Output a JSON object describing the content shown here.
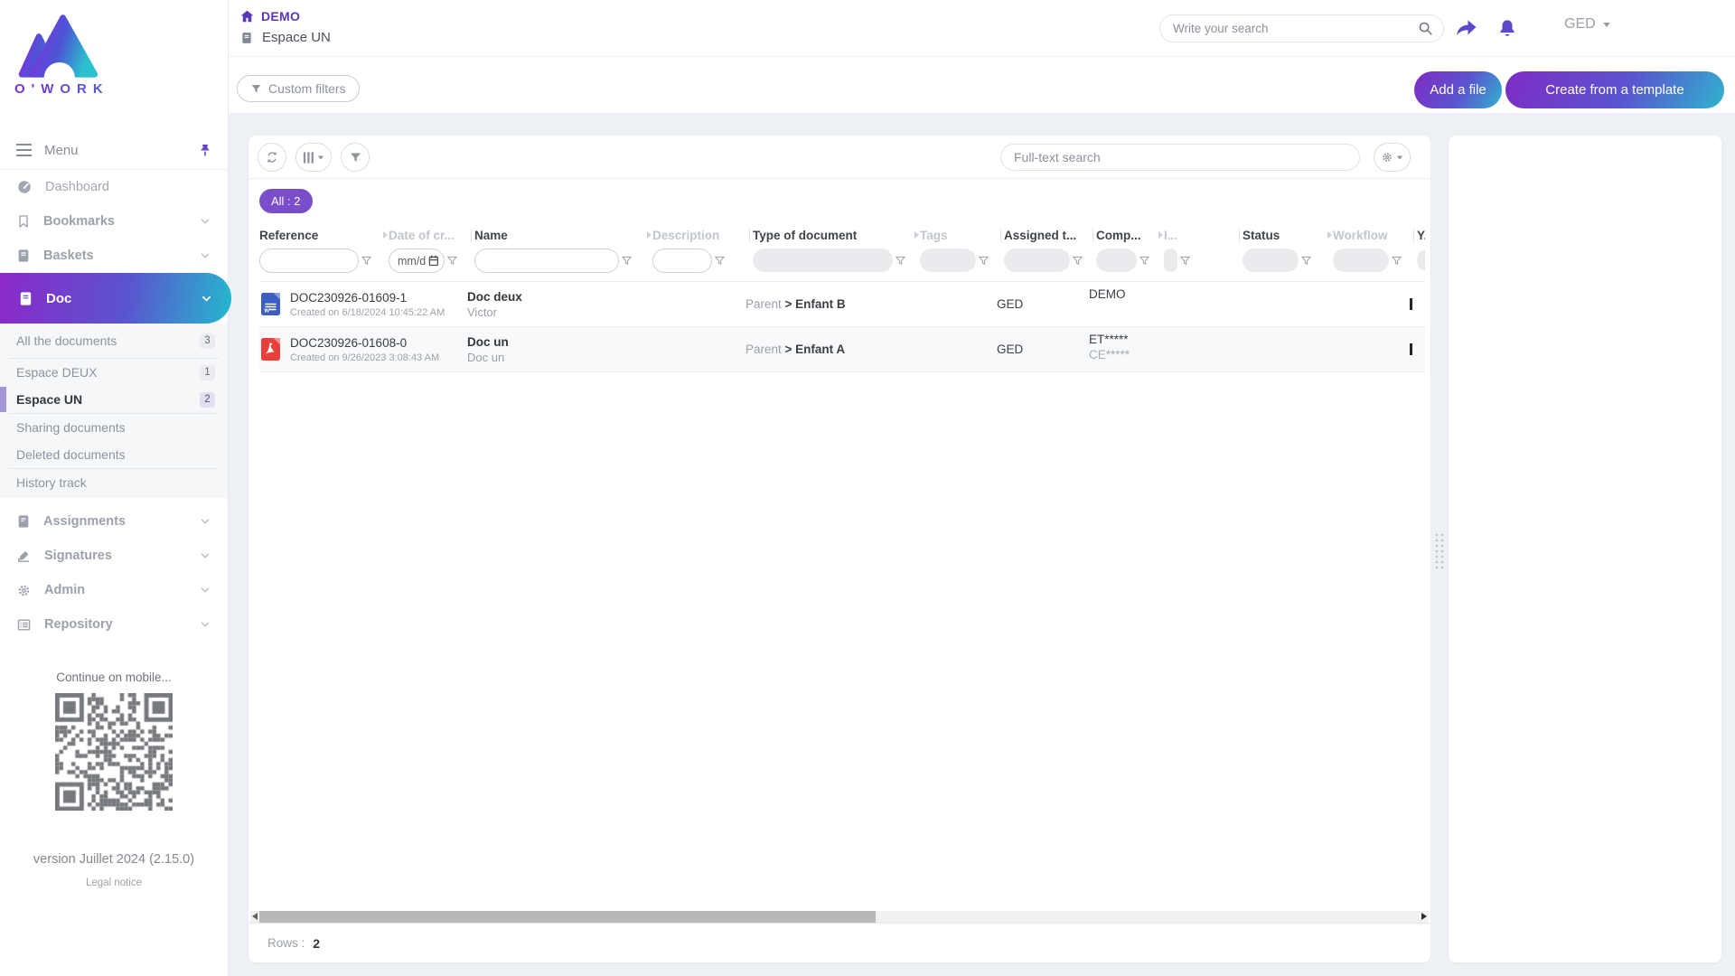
{
  "brand": {
    "name": "O'WORK"
  },
  "topbar": {
    "breadcrumb_root": "DEMO",
    "breadcrumb_page": "Espace UN",
    "search_placeholder": "Write your search",
    "user_label": "GED",
    "custom_filters_label": "Custom filters",
    "add_file_label": "Add a file",
    "create_template_label": "Create from a template"
  },
  "sidebar": {
    "menu_label": "Menu",
    "items": {
      "dashboard": "Dashboard",
      "bookmarks": "Bookmarks",
      "baskets": "Baskets",
      "doc": "Doc",
      "assignments": "Assignments",
      "signatures": "Signatures",
      "admin": "Admin",
      "repository": "Repository"
    },
    "doc_children": {
      "all_documents": {
        "label": "All the documents",
        "count": "3"
      },
      "espace_deux": {
        "label": "Espace DEUX",
        "count": "1"
      },
      "espace_un": {
        "label": "Espace UN",
        "count": "2"
      },
      "sharing": "Sharing documents",
      "deleted": "Deleted documents",
      "history": "History track"
    },
    "mobile_hint": "Continue on mobile...",
    "version": "version Juillet 2024 (2.15.0)",
    "legal": "Legal notice"
  },
  "table": {
    "fulltext_placeholder": "Full-text search",
    "filter_badge": "All : 2",
    "date_filter_placeholder": "mm/d",
    "columns": [
      {
        "label": "Reference",
        "muted": false
      },
      {
        "label": "Date of cr...",
        "muted": true
      },
      {
        "label": "Name",
        "muted": false
      },
      {
        "label": "Description",
        "muted": true
      },
      {
        "label": "Type of document",
        "muted": false
      },
      {
        "label": "Tags",
        "muted": true
      },
      {
        "label": "Assigned t...",
        "muted": false
      },
      {
        "label": "Comp...",
        "muted": false
      },
      {
        "label": "I...",
        "muted": true
      },
      {
        "label": "Status",
        "muted": false
      },
      {
        "label": "Workflow",
        "muted": true
      },
      {
        "label": "Y...",
        "muted": false
      }
    ],
    "rows": [
      {
        "file_type": "word",
        "reference": "DOC230926-01609-1",
        "created": "Created on 6/18/2024 10:45:22 AM",
        "name": "Doc deux",
        "name_sub": "Victor",
        "doc_type_parent": "Parent",
        "doc_type_child": "> Enfant B",
        "assigned_to": "GED",
        "company": "DEMO",
        "company_sub": ""
      },
      {
        "file_type": "pdf",
        "reference": "DOC230926-01608-0",
        "created": "Created on 9/26/2023 3:08:43 AM",
        "name": "Doc un",
        "name_sub": "Doc un",
        "doc_type_parent": "Parent",
        "doc_type_child": "> Enfant A",
        "assigned_to": "GED",
        "company": "ET*****",
        "company_sub": "CE*****"
      }
    ],
    "footer": {
      "rows_label": "Rows :",
      "rows_count": "2"
    }
  },
  "colors": {
    "accent_purple": "#5a49c8",
    "gradient_start": "#8c28c9",
    "gradient_end": "#24b8cd",
    "pill_purple": "#7a4ecb",
    "word_blue": "#3e5fc2",
    "pdf_red": "#e8403a"
  }
}
